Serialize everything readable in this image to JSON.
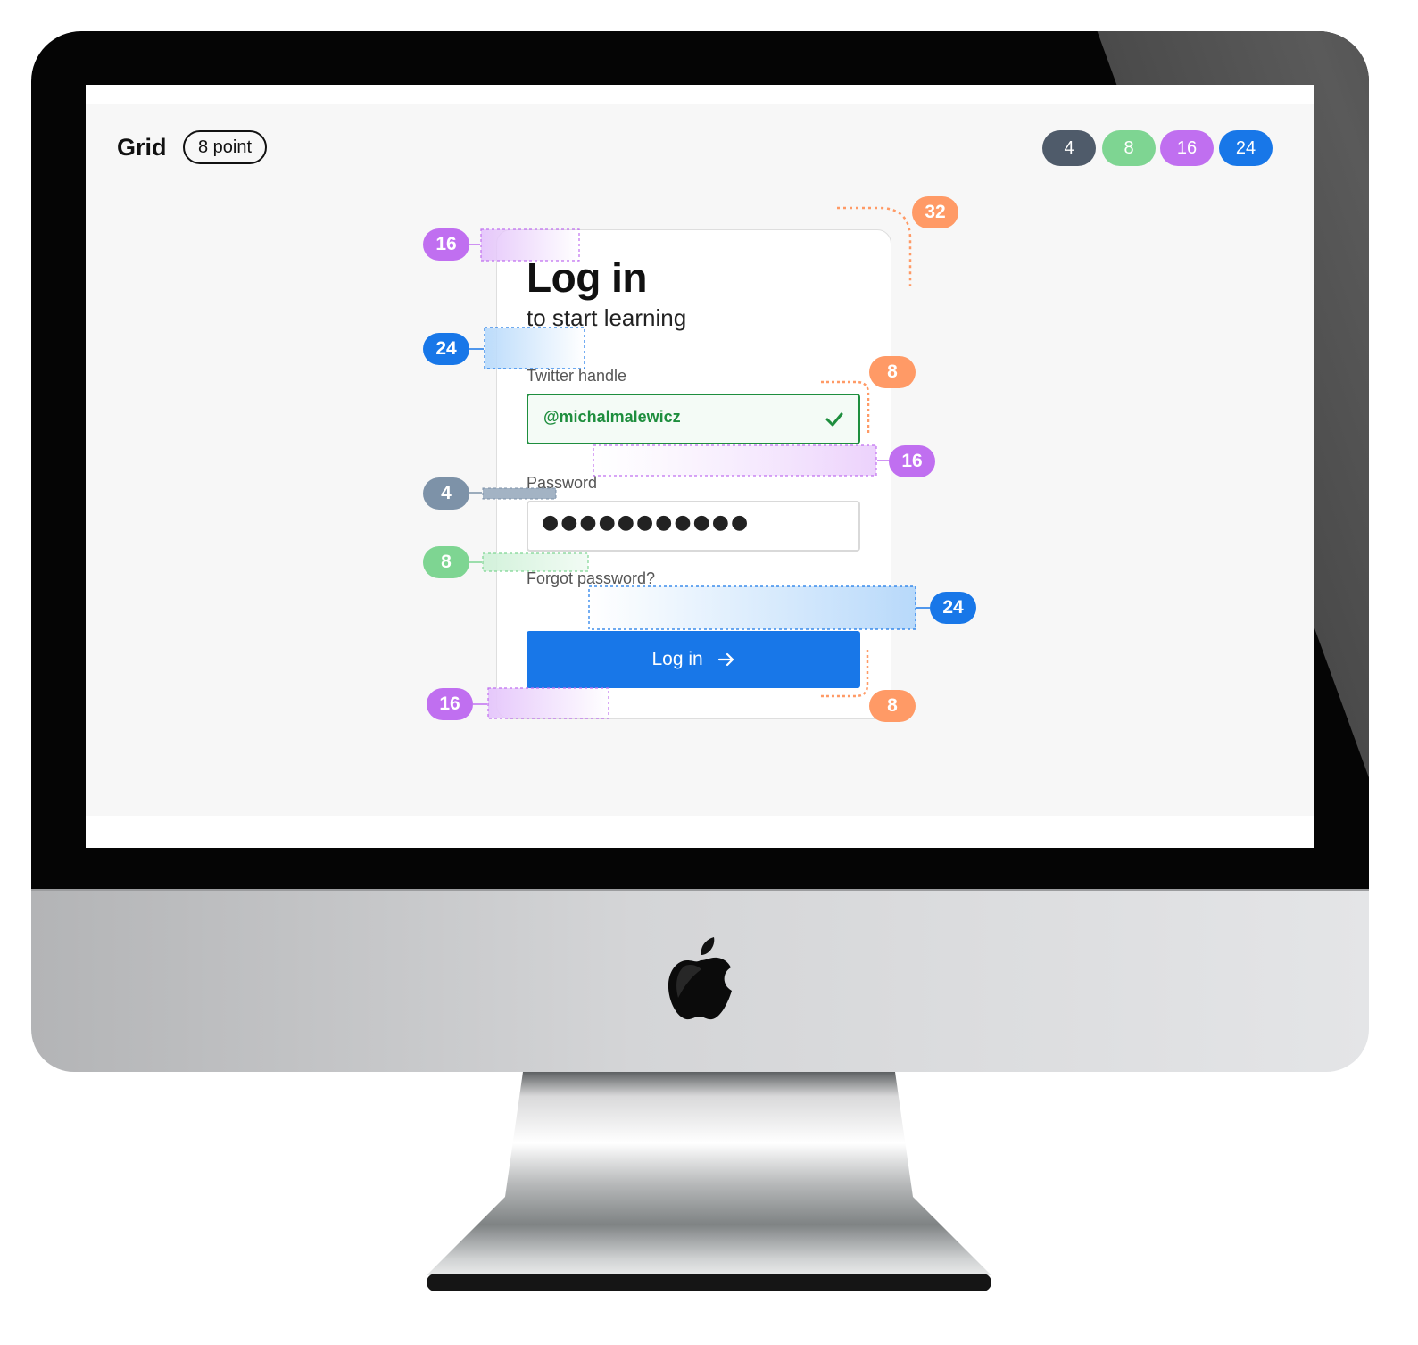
{
  "header": {
    "title": "Grid",
    "pill": "8 point"
  },
  "legend": [
    {
      "label": "4",
      "color": "#4f5b6a"
    },
    {
      "label": "8",
      "color": "#7ed592"
    },
    {
      "label": "16",
      "color": "#c06ff0"
    },
    {
      "label": "24",
      "color": "#1877e8"
    }
  ],
  "login": {
    "title": "Log in",
    "subtitle": "to start learning",
    "twitter_label": "Twitter handle",
    "twitter_value": "@michalmalewicz",
    "password_label": "Password",
    "password_value": "●●●●●●●●●●●",
    "forgot_link": "Forgot password?",
    "submit_label": "Log in",
    "submit_icon": "arrow-right-icon",
    "valid_icon": "checkmark-icon"
  },
  "annotations": {
    "card_radius": "32",
    "title_top": "16",
    "subtitle_gap": "24",
    "input_radius_top": "8",
    "input_gap": "16",
    "label_gap": "4",
    "forgot_gap": "8",
    "button_gap": "24",
    "card_bottom": "16",
    "button_radius": "8"
  },
  "colors": {
    "accent_blue": "#1877e8",
    "success_green": "#1e8e3e",
    "spacing_orange": "#ff9a66",
    "spacing_purple": "#c06ff0",
    "spacing_slate": "#7d92a8",
    "spacing_green": "#7ed592"
  }
}
